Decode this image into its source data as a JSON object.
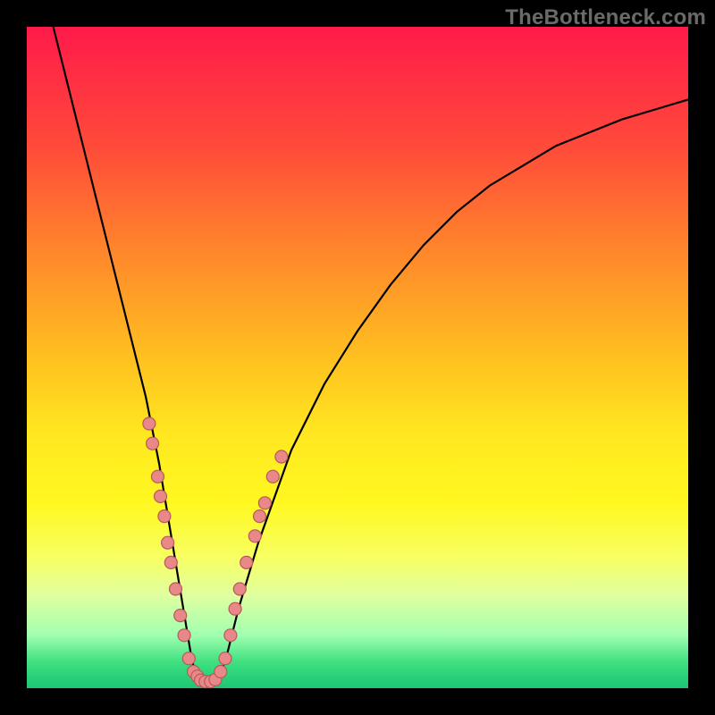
{
  "attribution": "TheBottleneck.com",
  "colors": {
    "page_bg": "#000000",
    "gradient_top": "#ff1a4a",
    "gradient_bottom": "#20c878",
    "curve": "#000000",
    "dot_fill": "#e98888",
    "dot_stroke": "#b85a5a",
    "attribution_text": "#6a6a6a"
  },
  "chart_data": {
    "type": "line",
    "title": "",
    "xlabel": "",
    "ylabel": "",
    "xlim": [
      0,
      100
    ],
    "ylim": [
      0,
      100
    ],
    "grid": false,
    "legend": false,
    "series": [
      {
        "name": "bottleneck-curve",
        "x": [
          4,
          6,
          8,
          10,
          12,
          14,
          16,
          18,
          20,
          21,
          22,
          23,
          24,
          25,
          26,
          27,
          28,
          29,
          30,
          32,
          35,
          40,
          45,
          50,
          55,
          60,
          65,
          70,
          75,
          80,
          85,
          90,
          95,
          100
        ],
        "y": [
          100,
          92,
          84,
          76,
          68,
          60,
          52,
          44,
          34,
          28,
          22,
          16,
          10,
          4,
          1,
          1,
          1,
          2,
          4,
          12,
          22,
          36,
          46,
          54,
          61,
          67,
          72,
          76,
          79,
          82,
          84,
          86,
          87.5,
          89
        ]
      }
    ],
    "markers": [
      {
        "x": 18.5,
        "y": 40
      },
      {
        "x": 19.0,
        "y": 37
      },
      {
        "x": 19.8,
        "y": 32
      },
      {
        "x": 20.2,
        "y": 29
      },
      {
        "x": 20.8,
        "y": 26
      },
      {
        "x": 21.3,
        "y": 22
      },
      {
        "x": 21.8,
        "y": 19
      },
      {
        "x": 22.5,
        "y": 15
      },
      {
        "x": 23.2,
        "y": 11
      },
      {
        "x": 23.8,
        "y": 8
      },
      {
        "x": 24.5,
        "y": 4.5
      },
      {
        "x": 25.2,
        "y": 2.5
      },
      {
        "x": 25.8,
        "y": 1.8
      },
      {
        "x": 26.3,
        "y": 1.2
      },
      {
        "x": 27.0,
        "y": 1.0
      },
      {
        "x": 27.8,
        "y": 1.0
      },
      {
        "x": 28.5,
        "y": 1.3
      },
      {
        "x": 29.3,
        "y": 2.5
      },
      {
        "x": 30.0,
        "y": 4.5
      },
      {
        "x": 30.8,
        "y": 8
      },
      {
        "x": 31.5,
        "y": 12
      },
      {
        "x": 32.2,
        "y": 15
      },
      {
        "x": 33.2,
        "y": 19
      },
      {
        "x": 34.5,
        "y": 23
      },
      {
        "x": 35.2,
        "y": 26
      },
      {
        "x": 36.0,
        "y": 28
      },
      {
        "x": 37.2,
        "y": 32
      },
      {
        "x": 38.5,
        "y": 35
      }
    ],
    "marker_radius": 7
  }
}
